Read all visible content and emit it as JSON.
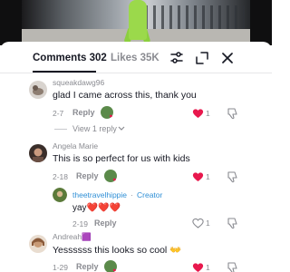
{
  "header": {
    "comments_label": "Comments 302",
    "likes_label": "Likes 35K"
  },
  "colors": {
    "heart_red": "#e8184d",
    "creator_blue": "#2f8fd6",
    "muted_text": "#8a8b91"
  },
  "comments": [
    {
      "username": "squeakdawg96",
      "text": "glad I came across this, thank you",
      "time": "2-7",
      "reply_label": "Reply",
      "likes": "1",
      "liked": true,
      "view_replies": "View 1 reply"
    },
    {
      "username": "Angela Marie",
      "text": "This is so perfect for us with kids",
      "time": "2-18",
      "reply_label": "Reply",
      "likes": "1",
      "liked": true,
      "reply": {
        "username": "theetravelhippie",
        "creator_label": "Creator",
        "text": "yay❤️❤️❤️",
        "time": "2-19",
        "reply_label": "Reply",
        "likes": "1",
        "liked": false
      }
    },
    {
      "username": "Andreah🟪",
      "text": "Yessssss this looks so cool 👐",
      "time": "1-29",
      "reply_label": "Reply",
      "likes": "1",
      "liked": true
    }
  ]
}
